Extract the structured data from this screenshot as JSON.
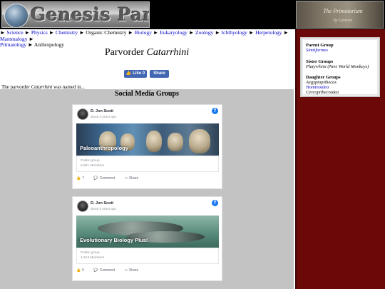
{
  "header": {
    "logo_text": "Genesis Panthesis",
    "primo_title": "The Primotarium",
    "primo_sub": "by Genesis"
  },
  "breadcrumb": {
    "separator": "►",
    "items": [
      "Science",
      "Physics",
      "Chemistry",
      "Organic Chemistry",
      "Biology",
      "Eukaryology",
      "Zoology",
      "Ichthyology",
      "Herpetology",
      "Mammalogy",
      "Primatology",
      "Anthropology"
    ]
  },
  "page": {
    "rank": "Parvorder",
    "taxon": "Catarrhini",
    "like_label": "Like 0",
    "share_label": "Share",
    "named_prefix": "The parvorder",
    "named_taxon": "Catarrhini",
    "named_suffix": "was named in..."
  },
  "sidebar": {
    "parent_heading": "Parent Group",
    "parent": "Simiiformes",
    "sister_heading": "Sister Groups",
    "sister": "Platyrrhini (New World Monkeys)",
    "daughter_heading": "Daughter Groups",
    "daughters": [
      "Aegyptopithecus",
      "Hominoidea",
      "Cercopithecoidea"
    ]
  },
  "social": {
    "title": "Social Media Groups",
    "cards": [
      {
        "author": "D. Jon Scott",
        "time": "about 5 years ago",
        "group_name": "Paleoanthropology",
        "group_type": "Public group",
        "members": "6,891 Members",
        "likes": "7",
        "comment_label": "Comment",
        "share_label": "Share"
      },
      {
        "author": "D. Jon Scott",
        "time": "about 5 years ago",
        "group_name": "Evolutionary Biology Plus!",
        "group_type": "Public group",
        "members": "1,613 Members",
        "likes": "5",
        "comment_label": "Comment",
        "share_label": "Share"
      }
    ]
  },
  "colors": {
    "sidebar_red": "#6b0909",
    "content_gray": "#c3c3c3",
    "link_blue": "#0000cc",
    "facebook_blue": "#4267b2"
  }
}
